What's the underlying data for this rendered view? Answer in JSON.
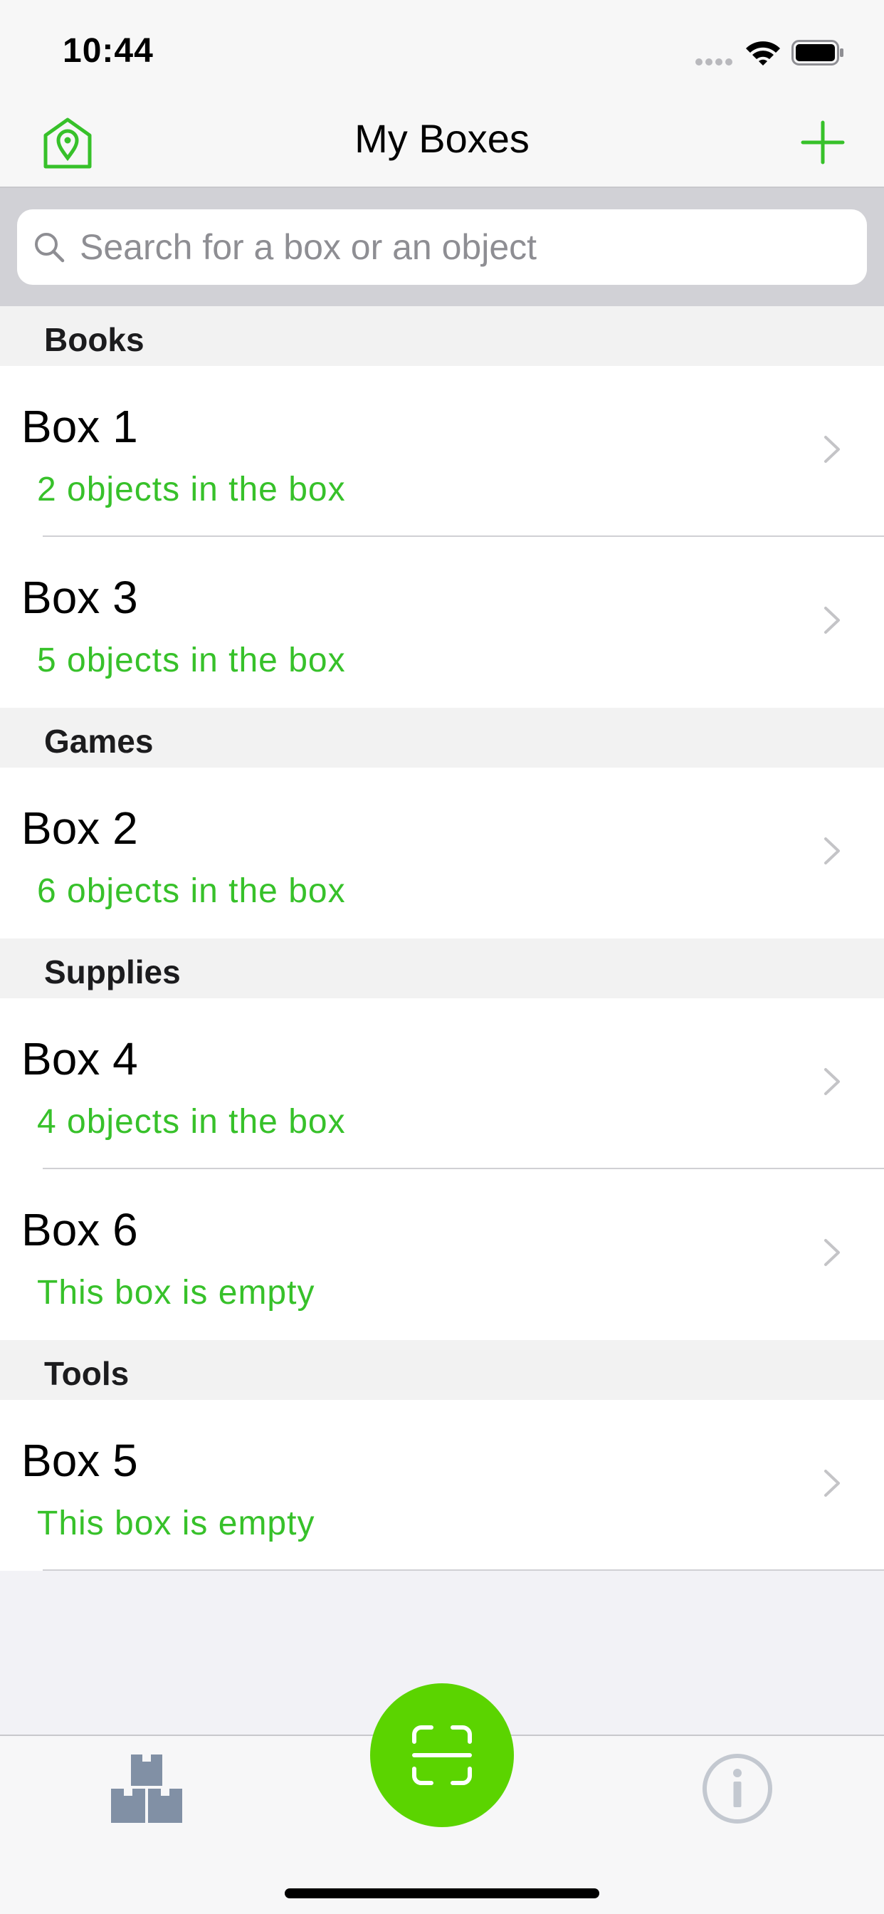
{
  "status_bar": {
    "time": "10:44"
  },
  "nav": {
    "title": "My Boxes",
    "location_icon": "location-pin-icon",
    "add_icon": "plus-icon"
  },
  "search": {
    "placeholder": "Search for a box or an object",
    "value": ""
  },
  "sections": [
    {
      "title": "Books",
      "rows": [
        {
          "title": "Box 1",
          "subtitle": "2 objects in the box"
        },
        {
          "title": "Box 3",
          "subtitle": "5 objects in the box"
        }
      ]
    },
    {
      "title": "Games",
      "rows": [
        {
          "title": "Box 2",
          "subtitle": "6 objects in the box"
        }
      ]
    },
    {
      "title": "Supplies",
      "rows": [
        {
          "title": "Box 4",
          "subtitle": "4 objects in the box"
        },
        {
          "title": "Box 6",
          "subtitle": "This box is empty"
        }
      ]
    },
    {
      "title": "Tools",
      "rows": [
        {
          "title": "Box 5",
          "subtitle": "This box is empty"
        }
      ]
    }
  ],
  "tab_bar": {
    "boxes_icon": "boxes-icon",
    "scan_icon": "scan-icon",
    "info_icon": "info-icon"
  },
  "colors": {
    "accent_green": "#37c12a",
    "fab_green": "#5bd400",
    "icon_gray": "#8190a5"
  }
}
